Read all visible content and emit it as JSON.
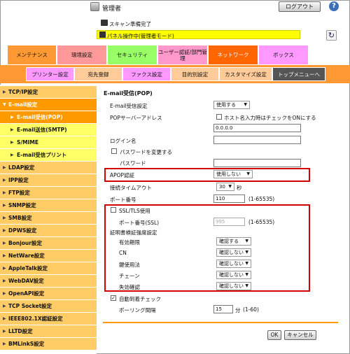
{
  "header": {
    "user": "管理者",
    "logout": "ログアウト",
    "help": "?",
    "status1": "スキャン準備完了",
    "status2": "パネル操作中(管理者モード)",
    "refresh": "↻"
  },
  "tabs": [
    "メンテナンス",
    "環境設定",
    "セキュリティ",
    "ユーザー認証/部門管理",
    "ネットワーク",
    "ボックス"
  ],
  "subtabs": [
    "プリンター設定",
    "宛先登録",
    "ファクス設定",
    "目的別設定",
    "カスタマイズ設定",
    "トップメニューへ"
  ],
  "sidebar": [
    "TCP/IP設定",
    "E-mail設定",
    "E-mail受信(POP)",
    "E-mail送信(SMTP)",
    "S/MIME",
    "E-mail受信プリント",
    "LDAP設定",
    "IPP設定",
    "FTP設定",
    "SNMP設定",
    "SMB設定",
    "DPWS設定",
    "Bonjour設定",
    "NetWare設定",
    "AppleTalk設定",
    "WebDAV設定",
    "OpenAPI設定",
    "TCP Socket設定",
    "IEEE802.1X認証設定",
    "LLTD設定",
    "BMLinkS設定"
  ],
  "form": {
    "title": "E-mail受信(POP)",
    "recv_label": "E-mail受信設定",
    "recv_value": "使用する",
    "pop_addr_label": "POPサーバーアドレス",
    "host_check": "ホスト名入力時はチェックをONにする",
    "pop_addr_value": "0.0.0.0",
    "login_label": "ログイン名",
    "pw_change": "パスワードを変更する",
    "pw_label": "パスワード",
    "apop_label": "APOP認証",
    "apop_value": "使用しない",
    "timeout_label": "接続タイムアウト",
    "timeout_value": "30",
    "timeout_unit": "秒",
    "port_label": "ポート番号",
    "port_value": "110",
    "port_range": "(1-65535)",
    "ssl_label": "SSL/TLS使用",
    "ssl_port_label": "ポート番号(SSL)",
    "ssl_port_value": "995",
    "ssl_port_range": "(1-65535)",
    "cert_label": "証明書検証強度設定",
    "validity_label": "有効期限",
    "validity_value": "確認する",
    "cn_label": "CN",
    "cn_value": "確認しない",
    "keyuse_label": "鍵使用法",
    "keyuse_value": "確認しない",
    "chain_label": "チェーン",
    "chain_value": "確認しない",
    "revoke_label": "失効確認",
    "revoke_value": "確認しない",
    "autocheck_label": "自動到着チェック",
    "poll_label": "ポーリング間隔",
    "poll_value": "15",
    "poll_unit": "分",
    "poll_range": "(1-60)",
    "ok": "OK",
    "cancel": "キャンセル"
  },
  "colors": {
    "accent": "#ff9900",
    "network_tab": "#ff6600",
    "sidebar_sub": "#ffff66",
    "highlight": "#d40000"
  }
}
